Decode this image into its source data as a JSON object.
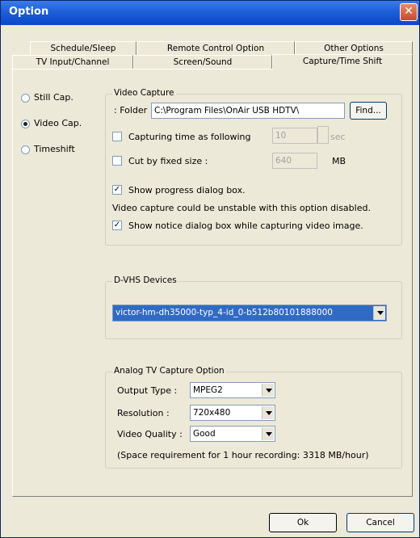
{
  "window": {
    "title": "Option",
    "close_glyph": "✕"
  },
  "tabs": {
    "row1": [
      "Schedule/Sleep",
      "Remote Control Option",
      "Other Options"
    ],
    "row2": [
      "TV Input/Channel",
      "Screen/Sound",
      "Capture/Time Shift"
    ],
    "active": "Capture/Time Shift"
  },
  "mode": {
    "options": [
      "Still Cap.",
      "Video Cap.",
      "Timeshift"
    ],
    "selected": "Video Cap."
  },
  "video_capture": {
    "legend": "Video Capture",
    "folder_label": ": Folder",
    "folder_value": "C:\\Program Files\\OnAir USB HDTV\\",
    "find_button": "Find...",
    "capture_time_label": "Capturing time as following",
    "capture_time_value": "10",
    "capture_time_unit": "sec",
    "cut_size_label": "Cut by fixed size :",
    "cut_size_value": "640",
    "cut_size_unit": "MB",
    "show_progress_label": "Show progress dialog box.",
    "unstable_note": "Video capture could be unstable with this option disabled.",
    "show_notice_label": "Show notice dialog box while capturing video image."
  },
  "dvhs": {
    "legend": "D-VHS Devices",
    "selected": "victor-hm-dh35000-typ_4-id_0-b512b80101888000"
  },
  "analog": {
    "legend": "Analog TV Capture Option",
    "output_type_label": "Output Type :",
    "output_type_value": "MPEG2",
    "resolution_label": "Resolution :",
    "resolution_value": "720x480",
    "quality_label": "Video Quality :",
    "quality_value": "Good",
    "space_note": "(Space requirement for 1 hour recording: 3318 MB/hour)"
  },
  "footer": {
    "ok": "Ok",
    "cancel": "Cancel"
  }
}
